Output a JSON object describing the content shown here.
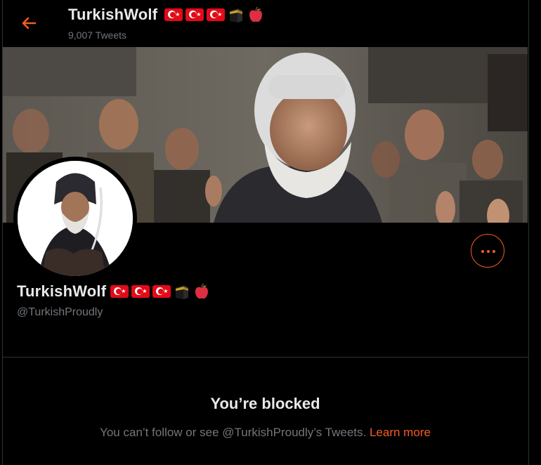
{
  "header": {
    "name": "TurkishWolf",
    "tweet_count": "9,007 Tweets"
  },
  "profile": {
    "name": "TurkishWolf",
    "handle": "@TurkishProudly",
    "name_emoji": [
      "turkey-flag",
      "turkey-flag",
      "turkey-flag",
      "kaaba",
      "red-apple"
    ]
  },
  "blocked": {
    "title": "You’re blocked",
    "description": "You can’t follow or see @TurkishProudly’s Tweets. ",
    "link": "Learn more"
  },
  "icons": {
    "back": "back-arrow-icon",
    "more": "more-options-icon"
  },
  "colors": {
    "accent": "#f45d22",
    "background": "#000000",
    "secondary_text": "#71767b"
  }
}
